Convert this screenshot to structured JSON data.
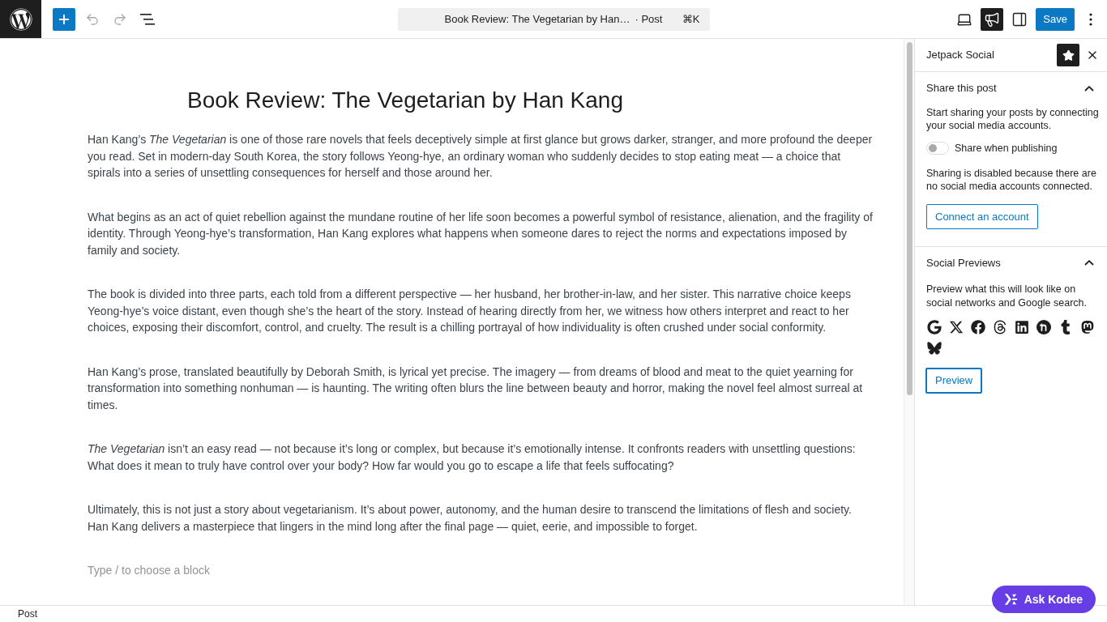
{
  "toolbar": {
    "history": [
      {
        "kind": "undo",
        "disabled": true
      },
      {
        "kind": "redo",
        "disabled": true
      }
    ],
    "command_bar": {
      "title": "Book Review: The Vegetarian by Han…",
      "post_type": "· Post",
      "shortcut": "⌘K"
    },
    "tools": [
      {
        "kind": "preview",
        "pressed": false
      },
      {
        "kind": "jetpack",
        "pressed": true
      },
      {
        "kind": "settings",
        "pressed": false
      }
    ],
    "save_button": "Save"
  },
  "post": {
    "title": "Book Review: The Vegetarian by Han Kang",
    "paragraphs": [
      "Han Kang’s *The Vegetarian* is one of those rare novels that feels deceptively simple at first glance but grows darker, stranger, and more profound the deeper you read. Set in modern-day South Korea, the story follows Yeong-hye, an ordinary woman who suddenly decides to stop eating meat — a choice that spirals into a series of unsettling consequences for herself and those around her.",
      "What begins as an act of quiet rebellion against the mundane routine of her life soon becomes a powerful symbol of resistance, alienation, and the fragility of identity. Through Yeong-hye’s transformation, Han Kang explores what happens when someone dares to reject the norms and expectations imposed by family and society.",
      "The book is divided into three parts, each told from a different perspective — her husband, her brother-in-law, and her sister. This narrative choice keeps Yeong-hye’s voice distant, even though she’s the heart of the story. Instead of hearing directly from her, we witness how others interpret and react to her choices, exposing their discomfort, control, and cruelty. The result is a chilling portrayal of how individuality is often crushed under social conformity.",
      "Han Kang’s prose, translated beautifully by Deborah Smith, is lyrical yet precise. The imagery — from dreams of blood and meat to the quiet yearning for transformation into something nonhuman — is haunting. The writing often blurs the line between beauty and horror, making the novel feel almost surreal at times.",
      "*The Vegetarian* isn’t an easy read — not because it’s long or complex, but because it’s emotionally intense. It confronts readers with unsettling questions: What does it mean to truly have control over your body? How far would you go to escape a life that feels suffocating?",
      "Ultimately, this is not just a story about vegetarianism. It’s about power, autonomy, and the human desire to transcend the limitations of flesh and society. Han Kang delivers a masterpiece that lingers in the mind long after the final page — quiet, eerie, and impossible to forget."
    ],
    "placeholder": "Type / to choose a block"
  },
  "sidebar": {
    "title": "Jetpack Social",
    "pinned": true,
    "share_panel": {
      "title": "Share this post",
      "expanded": true,
      "intro": "Start sharing your posts by connecting your social media accounts.",
      "toggle": {
        "label": "Share when publishing",
        "on": false
      },
      "notice": "Sharing is disabled because there are no social media accounts connected.",
      "button": "Connect an account"
    },
    "previews_panel": {
      "title": "Social Previews",
      "expanded": true,
      "description": "Preview what this will look like on social networks and Google search.",
      "button": "Preview"
    }
  },
  "status_bar": {
    "breadcrumb": "Post"
  },
  "assistant_button": "Ask Kodee"
}
